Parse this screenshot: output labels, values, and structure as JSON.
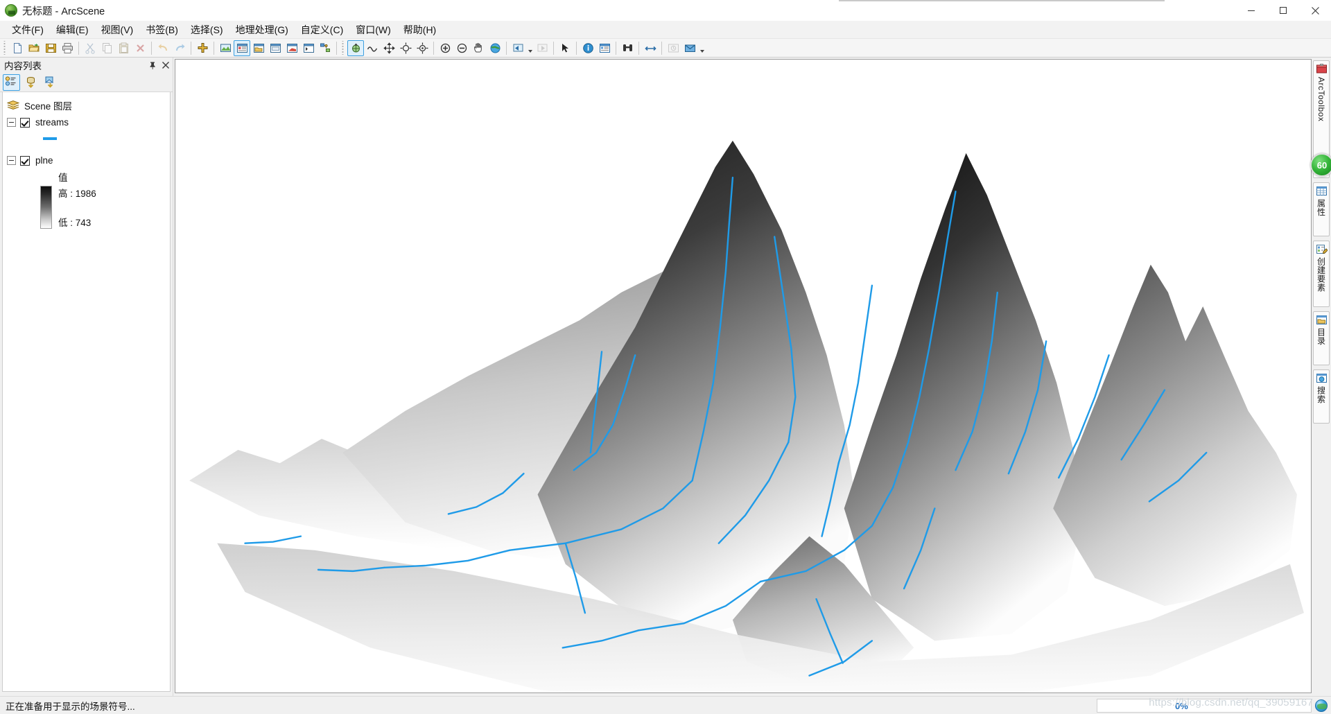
{
  "window": {
    "title": "无标题 - ArcScene",
    "app_icon": "arcscene-globe-icon",
    "minimize_label": "最小化",
    "maximize_label": "最大化",
    "close_label": "关闭"
  },
  "menu": {
    "items": [
      {
        "label": "文件(F)",
        "name": "menu-file"
      },
      {
        "label": "编辑(E)",
        "name": "menu-edit"
      },
      {
        "label": "视图(V)",
        "name": "menu-view"
      },
      {
        "label": "书签(B)",
        "name": "menu-bookmarks"
      },
      {
        "label": "选择(S)",
        "name": "menu-selection"
      },
      {
        "label": "地理处理(G)",
        "name": "menu-geoprocessing"
      },
      {
        "label": "自定义(C)",
        "name": "menu-customize"
      },
      {
        "label": "窗口(W)",
        "name": "menu-window"
      },
      {
        "label": "帮助(H)",
        "name": "menu-help"
      }
    ]
  },
  "toolbar": {
    "buttons": [
      {
        "icon": "new-document-icon",
        "label": "新建文档",
        "state": "enabled"
      },
      {
        "icon": "open-folder-icon",
        "label": "打开",
        "state": "enabled"
      },
      {
        "icon": "save-icon",
        "label": "保存",
        "state": "enabled"
      },
      {
        "icon": "print-icon",
        "label": "打印",
        "state": "enabled"
      },
      {
        "icon": "cut-scissors-icon",
        "label": "剪切",
        "state": "disabled"
      },
      {
        "icon": "copy-icon",
        "label": "复制",
        "state": "disabled"
      },
      {
        "icon": "paste-icon",
        "label": "粘贴",
        "state": "disabled"
      },
      {
        "icon": "delete-x-icon",
        "label": "删除",
        "state": "disabled"
      },
      {
        "icon": "undo-arrow-icon",
        "label": "撤消",
        "state": "disabled"
      },
      {
        "icon": "redo-arrow-icon",
        "label": "重做",
        "state": "disabled"
      },
      {
        "icon": "add-data-plus-icon",
        "label": "添加数据",
        "state": "enabled"
      },
      {
        "icon": "scene-properties-icon",
        "label": "场景属性",
        "state": "enabled"
      },
      {
        "icon": "toc-window-icon",
        "label": "内容列表",
        "state": "active"
      },
      {
        "icon": "catalog-window-icon",
        "label": "目录窗口",
        "state": "enabled"
      },
      {
        "icon": "layer-window-icon",
        "label": "图层窗口",
        "state": "enabled"
      },
      {
        "icon": "animation-window-icon",
        "label": "动画窗口",
        "state": "enabled"
      },
      {
        "icon": "python-window-icon",
        "label": "Python 窗口",
        "state": "enabled"
      },
      {
        "icon": "model-builder-icon",
        "label": "模型构建器",
        "state": "enabled"
      },
      {
        "icon": "navigate-icon",
        "label": "浏览",
        "state": "active"
      },
      {
        "icon": "fly-icon",
        "label": "飞行",
        "state": "enabled"
      },
      {
        "icon": "pan-3d-icon",
        "label": "平移",
        "state": "enabled"
      },
      {
        "icon": "zoom-target-icon",
        "label": "缩放至目标",
        "state": "enabled"
      },
      {
        "icon": "center-target-icon",
        "label": "置中于目标",
        "state": "enabled"
      },
      {
        "icon": "zoom-in-icon",
        "label": "放大",
        "state": "enabled"
      },
      {
        "icon": "zoom-out-icon",
        "label": "缩小",
        "state": "enabled"
      },
      {
        "icon": "hand-pan-icon",
        "label": "平移视图",
        "state": "enabled"
      },
      {
        "icon": "full-extent-globe-icon",
        "label": "全图",
        "state": "enabled"
      },
      {
        "icon": "zoom-prev-extent-icon",
        "label": "返回上一视图",
        "state": "enabled"
      },
      {
        "icon": "next-extent-icon",
        "label": "转到下一视图",
        "state": "disabled"
      },
      {
        "icon": "select-arrow-icon",
        "label": "选择要素",
        "state": "enabled"
      },
      {
        "icon": "identify-info-icon",
        "label": "识别",
        "state": "enabled"
      },
      {
        "icon": "html-popup-icon",
        "label": "HTML 弹出窗口",
        "state": "enabled"
      },
      {
        "icon": "find-binoculars-icon",
        "label": "查找",
        "state": "enabled"
      },
      {
        "icon": "measure-icon",
        "label": "测量",
        "state": "enabled"
      },
      {
        "icon": "time-slider-icon",
        "label": "时间滑块",
        "state": "disabled"
      },
      {
        "icon": "mail-map-icon",
        "label": "共享地图",
        "state": "enabled"
      }
    ]
  },
  "toc": {
    "title": "内容列表",
    "pin_icon": "pin-icon",
    "close_icon": "close-icon",
    "tabs": [
      {
        "icon": "list-by-drawing-order-icon",
        "label": "按绘制顺序列出",
        "state": "active"
      },
      {
        "icon": "list-by-source-icon",
        "label": "按源列出",
        "state": "enabled"
      },
      {
        "icon": "list-by-visibility-icon",
        "label": "按可见性列出",
        "state": "enabled"
      }
    ],
    "root": {
      "label": "Scene 图层",
      "icon": "layers-icon"
    },
    "layers": [
      {
        "name": "streams",
        "checked": true,
        "expanded": true,
        "symbol_type": "line",
        "symbol_color": "#1f9be8"
      },
      {
        "name": "plne",
        "checked": true,
        "expanded": true,
        "symbol_type": "raster-ramp",
        "value_heading": "值",
        "high_label": "高 : 1986",
        "low_label": "低 : 743",
        "ramp_top_color": "#000000",
        "ramp_bottom_color": "#ffffff"
      }
    ]
  },
  "scene": {
    "name": "3d-scene-view",
    "background": "#ffffff",
    "terrain_description": "灰度晕渲的三维山体 DEM",
    "stream_color": "#1f9be8"
  },
  "rightbar": {
    "tabs": [
      {
        "label": "ArcToolbox",
        "icon": "arctoolbox-icon"
      },
      {
        "label": "属性",
        "icon": "properties-table-icon"
      },
      {
        "label": "创建要素",
        "icon": "create-features-icon"
      },
      {
        "label": "目录",
        "icon": "catalog-icon"
      },
      {
        "label": "搜索",
        "icon": "search-icon"
      }
    ],
    "nav_badge": "60"
  },
  "statusbar": {
    "message": "正在准备用于显示的场景符号...",
    "progress_percent": "0%",
    "watermark": "https://blog.csdn.net/qq_39059167",
    "globe_icon": "globe-status-icon"
  }
}
